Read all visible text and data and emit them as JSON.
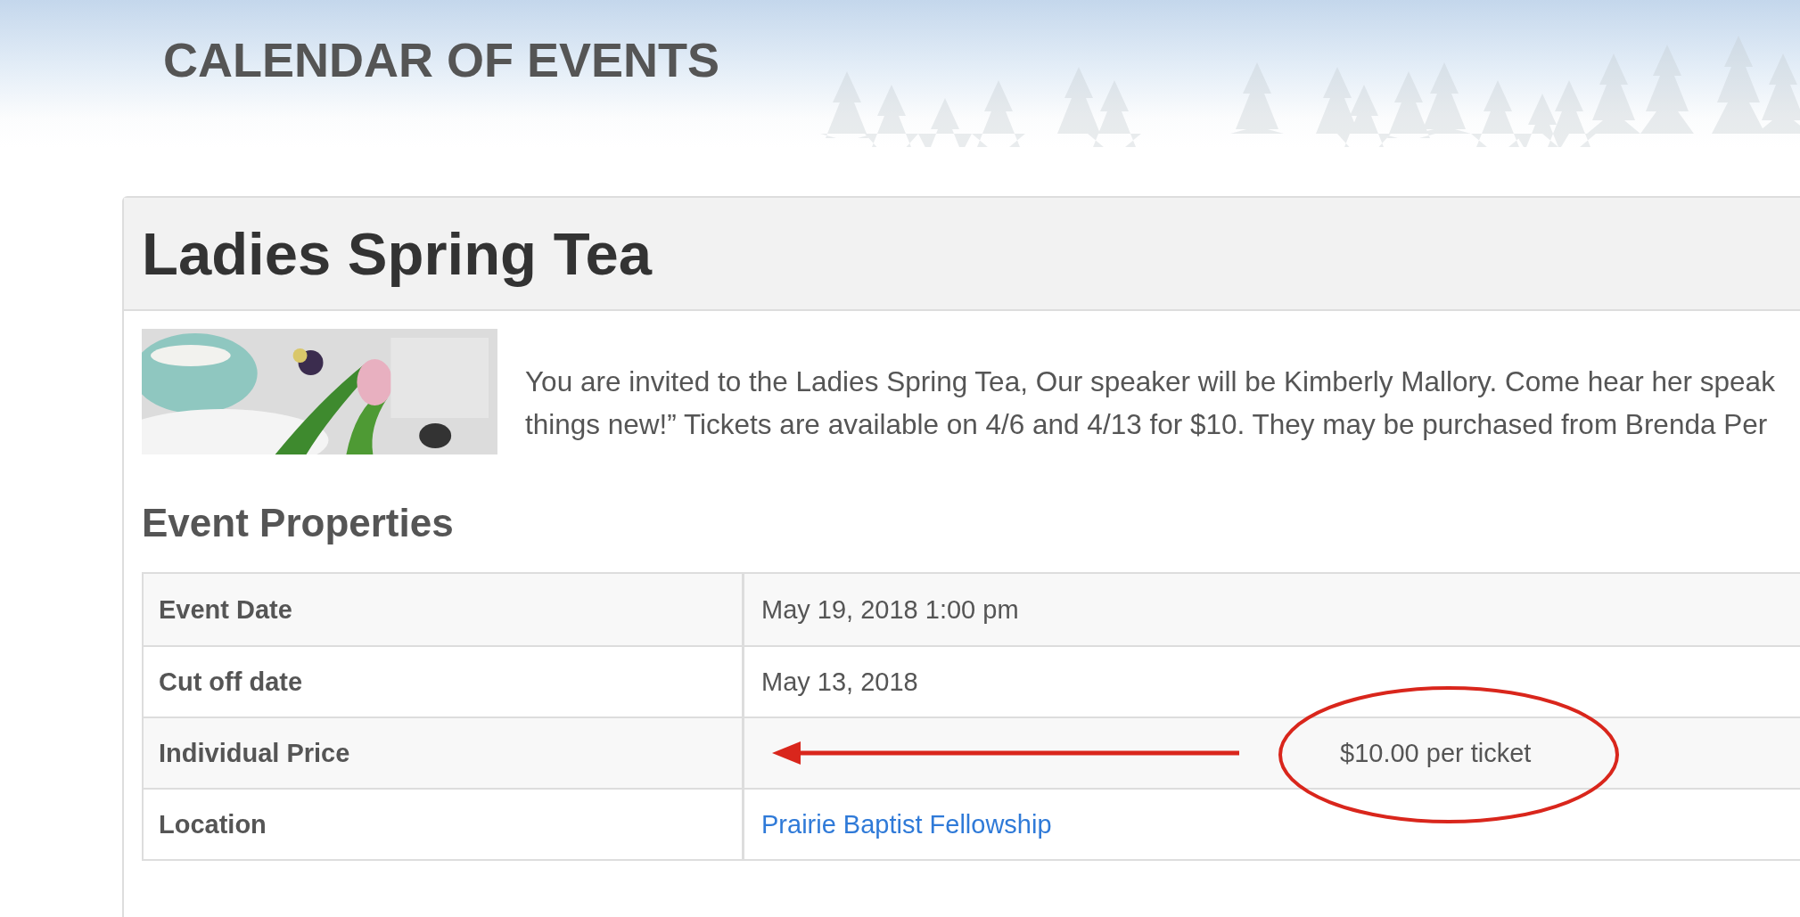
{
  "header": {
    "title": "CALENDAR OF EVENTS"
  },
  "event": {
    "title": "Ladies Spring Tea",
    "description_lines": [
      "You are invited to the Ladies Spring Tea, Our speaker will be Kimberly Mallory. Come hear her speak",
      "things new!” Tickets are available on 4/6 and 4/13 for $10. They may be purchased from Brenda Per"
    ]
  },
  "properties": {
    "heading": "Event Properties",
    "rows": [
      {
        "label": "Event Date",
        "value": "May 19, 2018 1:00 pm",
        "kind": "text",
        "annotated": false
      },
      {
        "label": "Cut off date",
        "value": "May 13, 2018",
        "kind": "text",
        "annotated": false
      },
      {
        "label": "Individual Price",
        "value": "$10.00 per ticket",
        "kind": "text",
        "annotated": true
      },
      {
        "label": "Location",
        "value": "Prairie Baptist Fellowship",
        "kind": "link",
        "annotated": false
      }
    ]
  }
}
